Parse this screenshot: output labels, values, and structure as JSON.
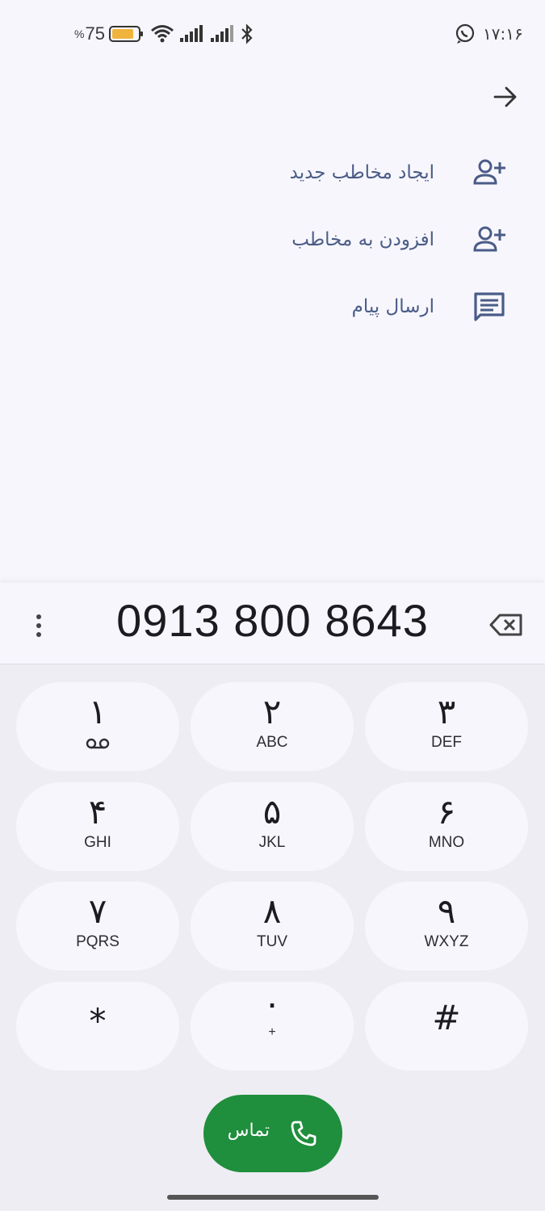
{
  "status_bar": {
    "battery_level": "75",
    "battery_percent_sign": "%",
    "time": "۱۷:۱۶",
    "icons": [
      "battery-icon",
      "wifi-icon",
      "signal-icon",
      "signal-icon",
      "bluetooth-icon",
      "whatsapp-icon"
    ]
  },
  "header": {
    "back_icon": "arrow-right-icon"
  },
  "actions": [
    {
      "label": "ایجاد مخاطب جدید",
      "icon": "person-add-icon"
    },
    {
      "label": "افزودن به مخاطب",
      "icon": "person-add-icon"
    },
    {
      "label": "ارسال پیام",
      "icon": "message-icon"
    }
  ],
  "dialer": {
    "number": "0913 800 8643",
    "more_icon": "more-vertical-icon",
    "backspace_icon": "backspace-icon",
    "keys": [
      {
        "digit": "۱",
        "letters": ""
      },
      {
        "digit": "۲",
        "letters": "ABC"
      },
      {
        "digit": "۳",
        "letters": "DEF"
      },
      {
        "digit": "۴",
        "letters": "GHI"
      },
      {
        "digit": "۵",
        "letters": "JKL"
      },
      {
        "digit": "۶",
        "letters": "MNO"
      },
      {
        "digit": "۷",
        "letters": "PQRS"
      },
      {
        "digit": "۸",
        "letters": "TUV"
      },
      {
        "digit": "۹",
        "letters": "WXYZ"
      },
      {
        "digit": "*",
        "letters": ""
      },
      {
        "digit": "۰",
        "letters": "+"
      },
      {
        "digit": "#",
        "letters": ""
      }
    ],
    "call_label": "تماس",
    "call_color": "#1f8e3d"
  },
  "colors": {
    "accent": "#4a5c87",
    "background": "#f7f6fc",
    "battery": "#f0b43c"
  }
}
